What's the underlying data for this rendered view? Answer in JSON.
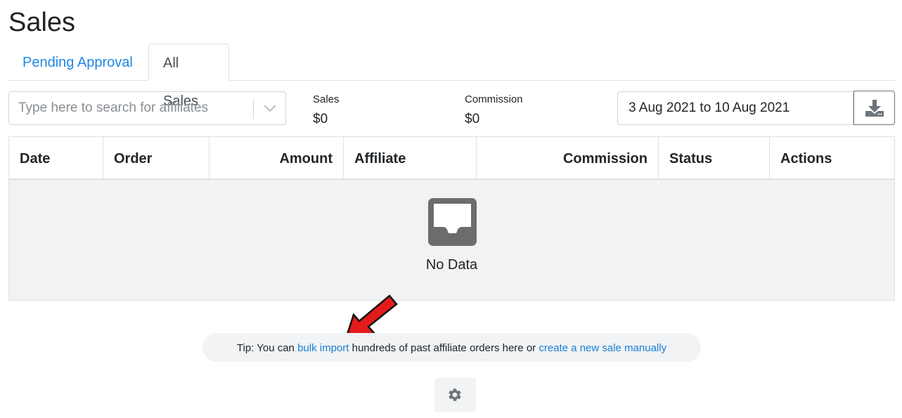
{
  "page": {
    "title": "Sales"
  },
  "tabs": [
    {
      "label": "Pending Approval",
      "active": false
    },
    {
      "label": "All Sales",
      "active": true
    }
  ],
  "filters": {
    "search_placeholder": "Type here to search for affiliates",
    "search_value": "",
    "date_range": "3 Aug 2021 to 10 Aug 2021"
  },
  "stats": {
    "sales_label": "Sales",
    "sales_value": "$0",
    "commission_label": "Commission",
    "commission_value": "$0"
  },
  "table": {
    "columns": [
      "Date",
      "Order",
      "Amount",
      "Affiliate",
      "Commission",
      "Status",
      "Actions"
    ],
    "rows": [],
    "empty_text": "No Data"
  },
  "tip": {
    "prefix": "Tip: You can ",
    "link1": "bulk import",
    "middle": " hundreds of past affiliate orders here or ",
    "link2": "create a new sale manually"
  },
  "icons": {
    "search_dropdown": "chevron-down-icon",
    "download": "download-icon",
    "empty": "inbox-icon",
    "settings": "gear-icon",
    "annotation": "red-arrow-icon"
  },
  "colors": {
    "link": "#1a7fd4",
    "annotation_arrow": "#e41b1b",
    "empty_bg": "#f2f2f2",
    "icon_gray": "#6c757d"
  }
}
